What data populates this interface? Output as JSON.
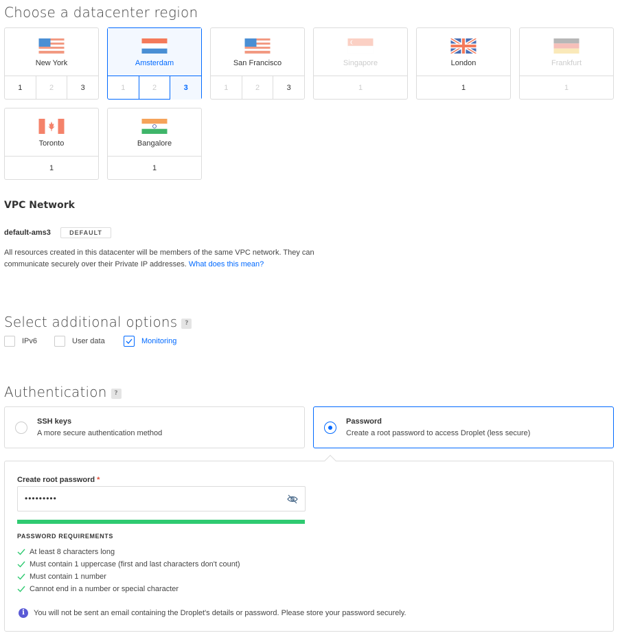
{
  "datacenter": {
    "title": "Choose a datacenter region",
    "regions": [
      {
        "name": "New York",
        "flag": "us-flag",
        "dcs": [
          "1",
          "2",
          "3"
        ],
        "disabled_dcs": [
          1
        ]
      },
      {
        "name": "Amsterdam",
        "flag": "nl-flag",
        "dcs": [
          "1",
          "2",
          "3"
        ],
        "selected": true,
        "active_dc": 2
      },
      {
        "name": "San Francisco",
        "flag": "us-flag",
        "dcs": [
          "1",
          "2",
          "3"
        ],
        "disabled_dcs": [
          0,
          1
        ]
      },
      {
        "name": "Singapore",
        "flag": "sg-flag",
        "dcs": [
          "1"
        ],
        "disabled": true
      },
      {
        "name": "London",
        "flag": "uk-flag",
        "dcs": [
          "1"
        ]
      },
      {
        "name": "Frankfurt",
        "flag": "de-flag",
        "dcs": [
          "1"
        ],
        "disabled": true
      },
      {
        "name": "Toronto",
        "flag": "ca-flag",
        "dcs": [
          "1"
        ]
      },
      {
        "name": "Bangalore",
        "flag": "in-flag",
        "dcs": [
          "1"
        ]
      }
    ]
  },
  "vpc": {
    "title": "VPC Network",
    "network_name": "default-ams3",
    "badge": "DEFAULT",
    "description": "All resources created in this datacenter will be members of the same VPC network. They can communicate securely over their Private IP addresses.",
    "link": "What does this mean?"
  },
  "options": {
    "title": "Select additional options",
    "help": "?",
    "items": [
      {
        "label": "IPv6",
        "checked": false
      },
      {
        "label": "User data",
        "checked": false
      },
      {
        "label": "Monitoring",
        "checked": true
      }
    ]
  },
  "auth": {
    "title": "Authentication",
    "help": "?",
    "methods": [
      {
        "title": "SSH keys",
        "subtitle": "A more secure authentication method",
        "selected": false
      },
      {
        "title": "Password",
        "subtitle": "Create a root password to access Droplet (less secure)",
        "selected": true
      }
    ],
    "password": {
      "label": "Create root password",
      "required_mark": "*",
      "value": "•••••••••",
      "requirements_title": "PASSWORD REQUIREMENTS",
      "requirements": [
        "At least 8 characters long",
        "Must contain 1 uppercase (first and last characters don't count)",
        "Must contain 1 number",
        "Cannot end in a number or special character"
      ],
      "strength": 1.0,
      "info": "You will not be sent an email containing the Droplet's details or password. Please store your password securely."
    }
  },
  "colors": {
    "accent": "#0069ff",
    "strength": "#2fca71",
    "info": "#5a5ad6"
  }
}
